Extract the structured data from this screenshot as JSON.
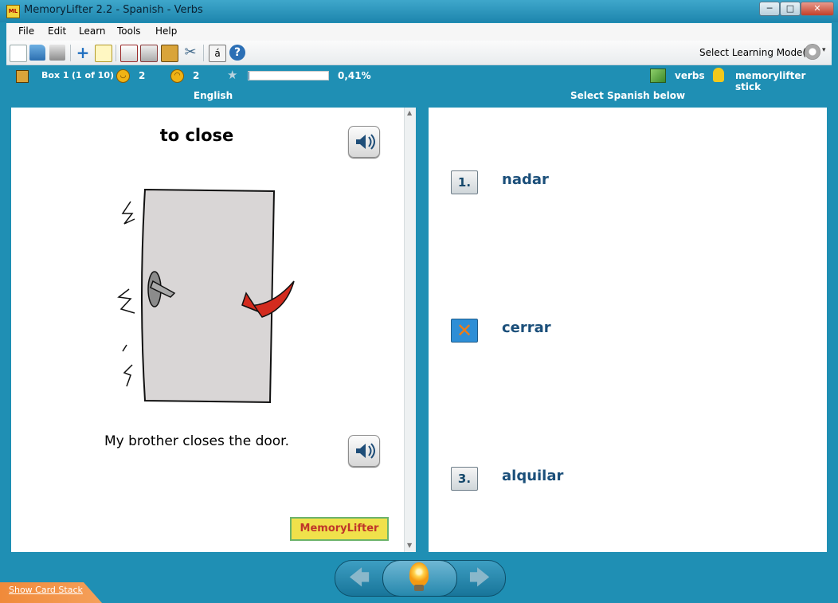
{
  "window": {
    "title": "MemoryLifter 2.2 - Spanish - Verbs",
    "icon_label": "ML",
    "controls": {
      "minimize": "─",
      "maximize": "□",
      "close": "✕"
    }
  },
  "menubar": {
    "items": [
      "File",
      "Edit",
      "Learn",
      "Tools",
      "Help"
    ]
  },
  "toolbar": {
    "learning_mode_label": "Select Learning Mode(s)",
    "arrow": "▾"
  },
  "status": {
    "box": "Box 1",
    "box_count": "(1 of 10)",
    "good_count": "2",
    "bad_count": "2",
    "progress_percent": "0,41%",
    "progress_fraction": 0.0041,
    "star": "★",
    "chapter": "verbs",
    "user": "memorylifter stick"
  },
  "columns": {
    "question": "English",
    "answer": "Select Spanish below"
  },
  "card": {
    "question": "to close",
    "example": "My brother closes the door.",
    "logo": "MemoryLifter"
  },
  "answers": [
    {
      "number": "1.",
      "text": "nadar"
    },
    {
      "number": "✕",
      "text": "cerrar"
    },
    {
      "number": "3.",
      "text": "alquilar"
    }
  ],
  "bottom": {
    "show_card_stack": "Show Card Stack",
    "back_arrow": "🡄",
    "next_arrow": "🡆"
  },
  "colors": {
    "chrome": "#1f8fb4",
    "answer_text": "#1b4f7a",
    "accent_orange": "#f08a3a"
  }
}
